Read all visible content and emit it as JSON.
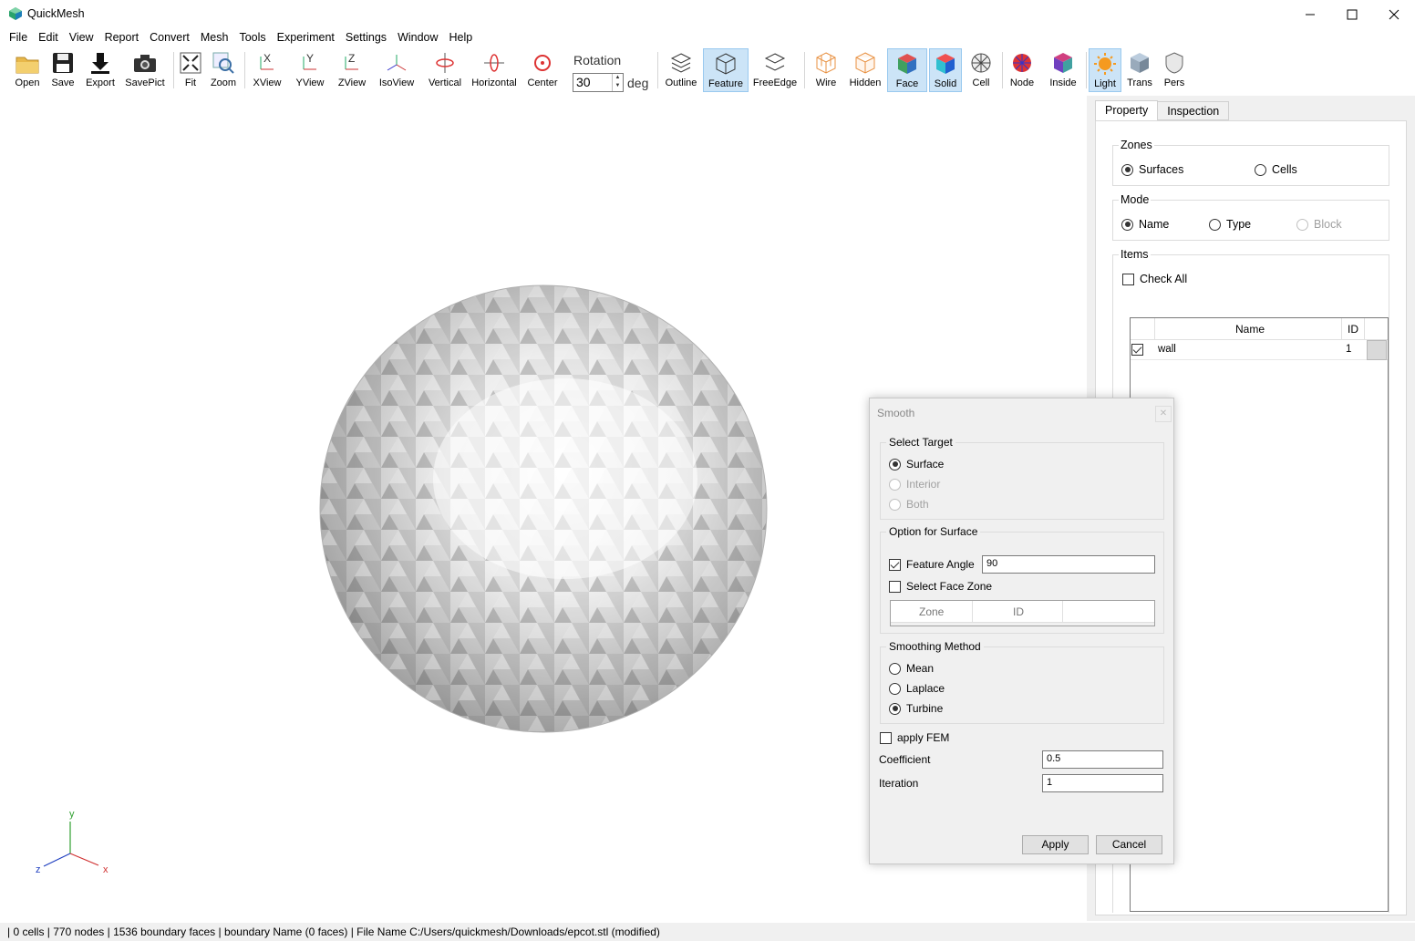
{
  "app": {
    "title": "QuickMesh"
  },
  "window_controls": {
    "minimize": "—",
    "maximize": "☐",
    "close": "✕"
  },
  "menu": [
    "File",
    "Edit",
    "View",
    "Report",
    "Convert",
    "Mesh",
    "Tools",
    "Experiment",
    "Settings",
    "Window",
    "Help"
  ],
  "toolbar": {
    "buttons": [
      "Open",
      "Save",
      "Export",
      "SavePict",
      "Fit",
      "Zoom",
      "XView",
      "YView",
      "ZView",
      "IsoView",
      "Vertical",
      "Horizontal",
      "Center",
      "Outline",
      "Feature",
      "FreeEdge",
      "Wire",
      "Hidden",
      "Face",
      "Solid",
      "Cell",
      "Node",
      "Inside",
      "Light",
      "Trans",
      "Pers"
    ],
    "active": [
      "Feature",
      "Face",
      "Solid",
      "Light"
    ],
    "rotation_label": "Rotation",
    "rotation_value": "30",
    "rotation_unit": "deg"
  },
  "axes": {
    "x": "x",
    "y": "y",
    "z": "z"
  },
  "panel": {
    "tabs": [
      "Property",
      "Inspection"
    ],
    "active_tab": "Property",
    "zones": {
      "title": "Zones",
      "options": [
        "Surfaces",
        "Cells"
      ],
      "selected": "Surfaces"
    },
    "mode": {
      "title": "Mode",
      "options": [
        "Name",
        "Type",
        "Block"
      ],
      "selected": "Name",
      "disabled": [
        "Block"
      ]
    },
    "items": {
      "title": "Items",
      "check_all": "Check All",
      "columns": [
        "Name",
        "ID"
      ],
      "rows": [
        {
          "checked": true,
          "name": "wall",
          "id": "1"
        }
      ]
    }
  },
  "dialog": {
    "title": "Smooth",
    "close": "✕",
    "select_target": {
      "title": "Select Target",
      "options": [
        "Surface",
        "Interior",
        "Both"
      ],
      "selected": "Surface",
      "disabled": [
        "Interior",
        "Both"
      ]
    },
    "option_surface": {
      "title": "Option for Surface",
      "feature_angle_label": "Feature Angle",
      "feature_angle_checked": true,
      "feature_angle_value": "90",
      "select_face_zone_label": "Select Face Zone",
      "select_face_zone_checked": false,
      "columns": [
        "Zone",
        "ID"
      ]
    },
    "smoothing_method": {
      "title": "Smoothing Method",
      "options": [
        "Mean",
        "Laplace",
        "Turbine"
      ],
      "selected": "Turbine"
    },
    "apply_fem_label": "apply FEM",
    "apply_fem_checked": false,
    "coefficient_label": "Coefficient",
    "coefficient_value": "0.5",
    "iteration_label": "Iteration",
    "iteration_value": "1",
    "apply_button": "Apply",
    "cancel_button": "Cancel"
  },
  "status": {
    "text": "| 0 cells | 770 nodes | 1536 boundary faces |  boundary Name  (0 faces) | File Name C:/Users/quickmesh/Downloads/epcot.stl (modified)"
  },
  "colors": {
    "toolbar_active_bg": "#cce4f7",
    "panel_bg": "#f0f0f0",
    "mesh_light": "#f4f4f4",
    "mesh_dark": "#8a8a8a",
    "axis_x": "#d03030",
    "axis_y": "#30a030",
    "axis_z": "#2040c0"
  }
}
